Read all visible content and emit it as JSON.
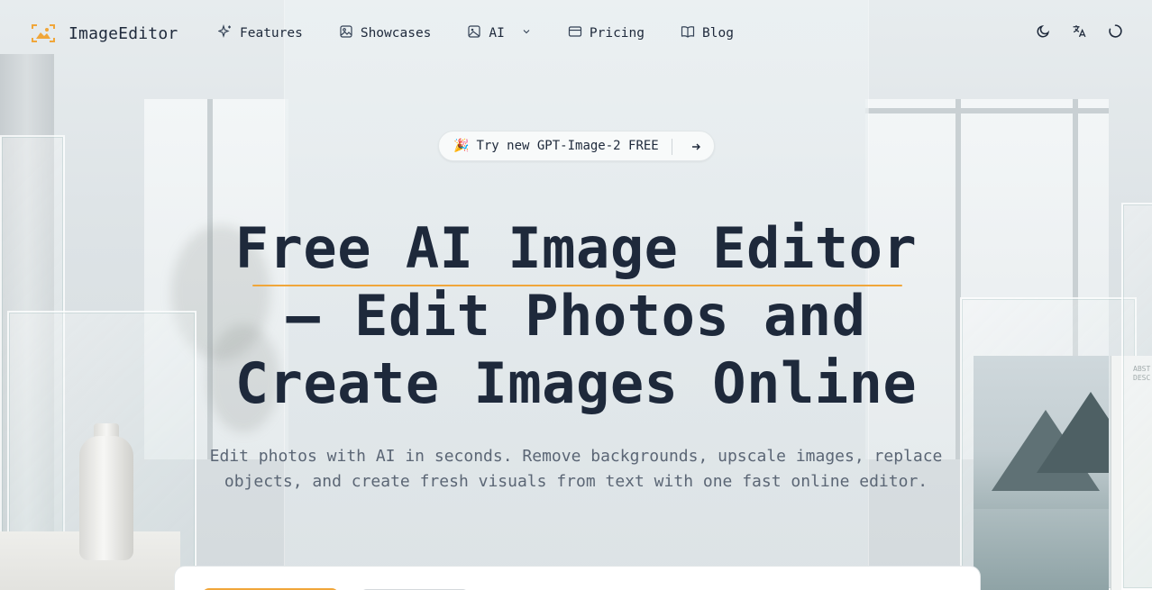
{
  "brand": {
    "name": "ImageEditor",
    "accent_color": "#f0a63a",
    "icon": "image-frame-icon"
  },
  "nav": {
    "items": [
      {
        "label": "Features",
        "icon": "sparkles-icon"
      },
      {
        "label": "Showcases",
        "icon": "image-icon"
      },
      {
        "label": "AI",
        "icon": "image-ai-icon",
        "has_dropdown": true
      },
      {
        "label": "Pricing",
        "icon": "credit-card-icon"
      },
      {
        "label": "Blog",
        "icon": "book-open-icon"
      }
    ]
  },
  "header_tools": [
    {
      "name": "theme-toggle",
      "icon": "moon-icon"
    },
    {
      "name": "language-switcher",
      "icon": "translate-icon"
    },
    {
      "name": "account",
      "icon": "loading-spinner-icon"
    }
  ],
  "hero": {
    "promo": {
      "emoji": "🎉",
      "text": "Try new GPT-Image-2 FREE",
      "icon": "arrow-right-icon"
    },
    "title_line1": "Free AI Image Editor",
    "title_line2": "– Edit Photos and",
    "title_line3": "Create Images Online",
    "subtitle_line1": "Edit photos with AI in seconds. Remove backgrounds, upscale images, replace",
    "subtitle_line2": "objects, and create fresh visuals from text with one fast online editor."
  },
  "colors": {
    "text": "#1e293b",
    "muted_text": "#5b6675",
    "underline": "#f0a63a"
  }
}
